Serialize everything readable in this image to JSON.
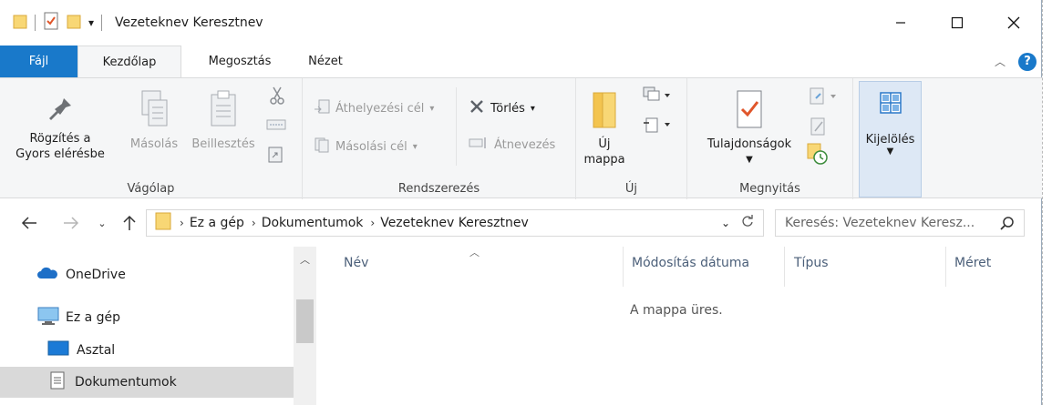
{
  "window": {
    "title": "Vezeteknev Keresztnev"
  },
  "tabs": [
    {
      "label": "Fájl"
    },
    {
      "label": "Kezdőlap"
    },
    {
      "label": "Megosztás"
    },
    {
      "label": "Nézet"
    }
  ],
  "ribbon": {
    "clipboard": {
      "pin_label": "Rögzítés a Gyors elérésbe",
      "pin_label_1": "Rögzítés a",
      "pin_label_2": "Gyors elérésbe",
      "copy_label": "Másolás",
      "paste_label": "Beillesztés",
      "group_label": "Vágólap"
    },
    "organize": {
      "move_to_label": "Áthelyezési cél",
      "copy_to_label": "Másolási cél",
      "delete_label": "Törlés",
      "rename_label": "Átnevezés",
      "group_label": "Rendszerezés"
    },
    "new": {
      "new_folder_label_1": "Új",
      "new_folder_label_2": "mappa",
      "group_label": "Új"
    },
    "open": {
      "properties_label": "Tulajdonságok",
      "group_label": "Megnyitás"
    },
    "select": {
      "select_label": "Kijelölés"
    }
  },
  "address": {
    "crumbs": [
      "Ez a gép",
      "Dokumentumok",
      "Vezeteknev Keresztnev"
    ]
  },
  "search": {
    "placeholder": "Keresés: Vezeteknev Keresz..."
  },
  "navpane": {
    "items": [
      {
        "label": "OneDrive"
      },
      {
        "label": "Ez a gép"
      },
      {
        "label": "Asztal"
      },
      {
        "label": "Dokumentumok"
      }
    ]
  },
  "content": {
    "columns": [
      "Név",
      "Módosítás dátuma",
      "Típus",
      "Méret"
    ],
    "empty_text": "A mappa üres."
  },
  "colors": {
    "file_tab": "#1979ca",
    "ribbon_bg": "#f5f6f7",
    "folder_yellow": "#f8d775",
    "selection": "#d9d9d9"
  }
}
